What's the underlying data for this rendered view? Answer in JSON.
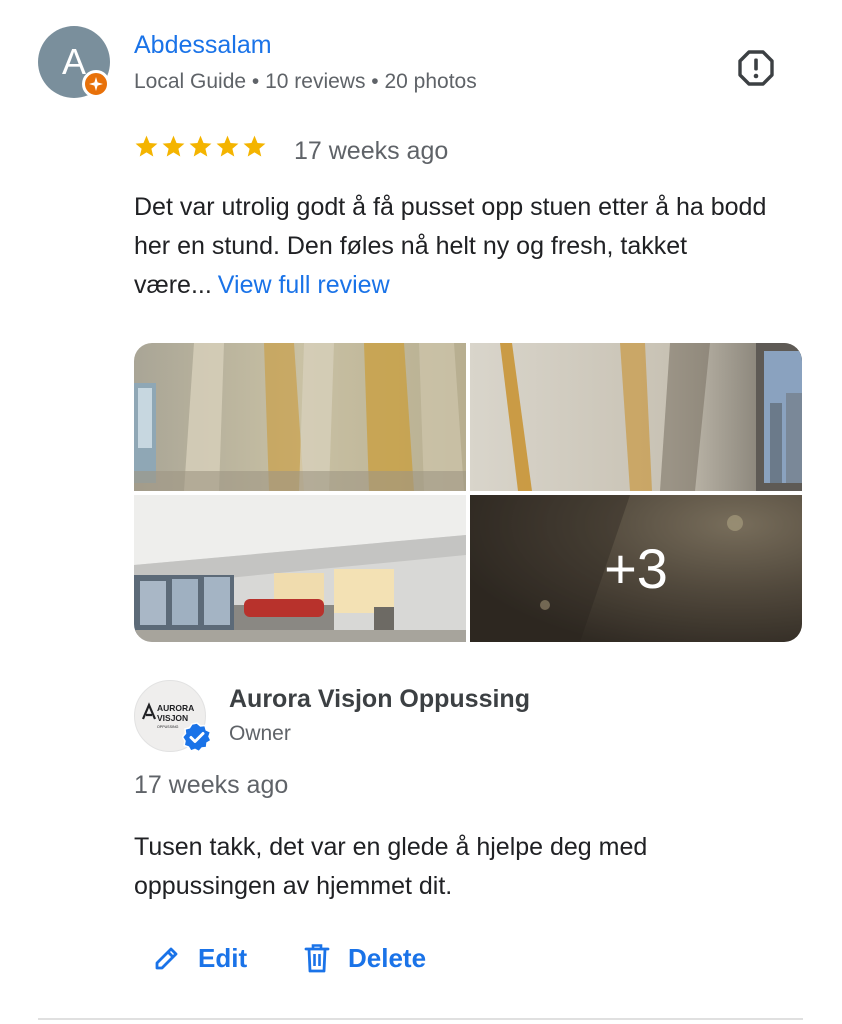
{
  "review": {
    "reviewer_initial": "A",
    "reviewer_name": "Abdessalam",
    "reviewer_meta": "Local Guide • 10 reviews • 20 photos",
    "rating": 5,
    "rating_max": 5,
    "time": "17 weeks ago",
    "text": "Det var utrolig godt å få pusset opp stuen etter å ha bodd her en stund. Den føles nå helt ny og fresh, takket være...",
    "view_full_label": "View full review",
    "report_icon": "report-flag-icon",
    "photos": {
      "more_count": "+3"
    }
  },
  "owner_reply": {
    "logo_line1": "AURORA",
    "logo_line2": "VISJON",
    "logo_line3": "OPPUSSING",
    "name": "Aurora Visjon Oppussing",
    "role": "Owner",
    "time": "17 weeks ago",
    "text": "Tusen takk, det var en glede å hjelpe deg med oppussingen av hjemmet dit."
  },
  "actions": {
    "edit_label": "Edit",
    "delete_label": "Delete"
  },
  "colors": {
    "link": "#1a73e8",
    "star": "#f4b400",
    "local_guide_badge": "#e8710a",
    "avatar_bg": "#7a8f9c",
    "verified": "#1a73e8"
  }
}
